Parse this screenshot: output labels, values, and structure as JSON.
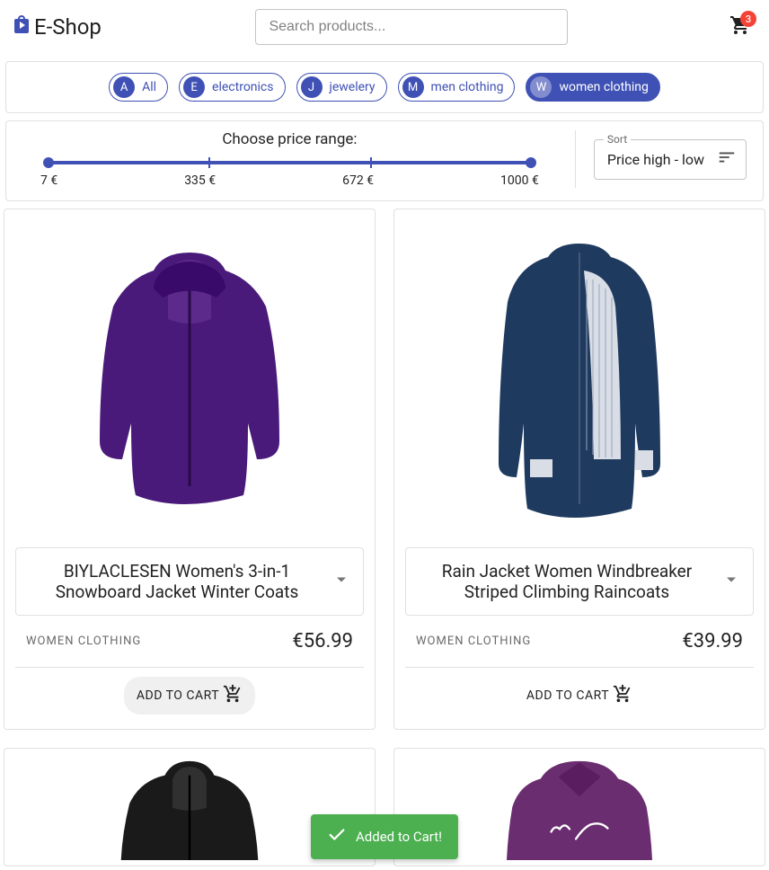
{
  "header": {
    "brand": "E-Shop",
    "search_placeholder": "Search products...",
    "cart_count": "3"
  },
  "chips": [
    {
      "avatar": "A",
      "label": "All",
      "active": false
    },
    {
      "avatar": "E",
      "label": "electronics",
      "active": false
    },
    {
      "avatar": "J",
      "label": "jewelery",
      "active": false
    },
    {
      "avatar": "M",
      "label": "men clothing",
      "active": false
    },
    {
      "avatar": "W",
      "label": "women clothing",
      "active": true
    }
  ],
  "price_range": {
    "title": "Choose price range:",
    "marks": [
      "7 €",
      "335 €",
      "672 €",
      "1000 €"
    ]
  },
  "sort": {
    "label": "Sort",
    "value": "Price high - low"
  },
  "products": [
    {
      "title": "BIYLACLESEN Women's 3-in-1 Snowboard Jacket Winter Coats",
      "category": "WOMEN CLOTHING",
      "price": "€56.99",
      "add_label": "ADD TO CART",
      "add_hover": true
    },
    {
      "title": "Rain Jacket Women Windbreaker Striped Climbing Raincoats",
      "category": "WOMEN CLOTHING",
      "price": "€39.99",
      "add_label": "ADD TO CART",
      "add_hover": false
    }
  ],
  "toast": {
    "message": "Added to Cart!"
  }
}
